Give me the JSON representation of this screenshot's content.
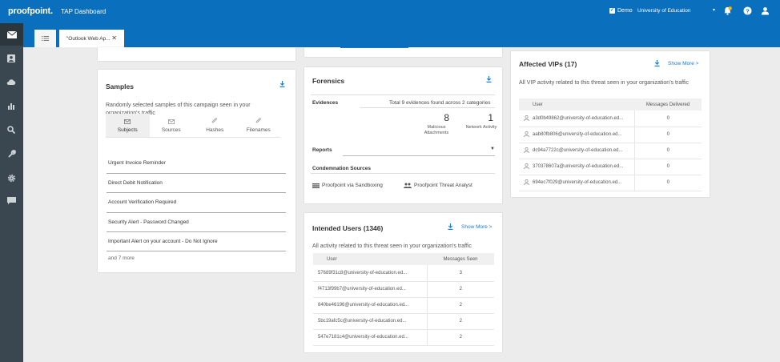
{
  "header": {
    "logo": "proofpoint.",
    "title": "TAP Dashboard",
    "demo_label": "Demo",
    "organization": "University of Education"
  },
  "tabs": [
    {
      "label": "\"Outlook Web Ap...",
      "close": "✕"
    }
  ],
  "samples": {
    "title": "Samples",
    "description": "Randomly selected samples of this campaign seen in your organization's traffic",
    "tabs": [
      "Subjects",
      "Sources",
      "Hashes",
      "Filenames"
    ],
    "subjects": [
      "Urgent Invoice Reminder",
      "Direct Debit Notification",
      "Account Verification Required",
      "Security Alert - Password Changed",
      "Important Alert on your account - Do Not Ignore"
    ],
    "more": "and 7 more"
  },
  "forensics": {
    "title": "Forensics",
    "evidences_label": "Evidences",
    "evidences_summary": "Total 9 evidences found across 2 categories",
    "malicious_count": "8",
    "malicious_label_1": "Malicious",
    "malicious_label_2": "Attachments",
    "network_count": "1",
    "network_label": "Network Activity",
    "reports_label": "Reports",
    "condemnation_label": "Condemnation Sources",
    "sources": [
      "Proofpoint via Sandboxing",
      "Proofpoint Threat Analyst"
    ]
  },
  "intended_users": {
    "title": "Intended Users (1346)",
    "show_more": "Show More >",
    "description": "All activity related to this threat seen in your organization's traffic",
    "columns": [
      "User",
      "Messages Seen"
    ],
    "rows": [
      {
        "user": "57689f31c8@university-of-education.ed...",
        "count": "3"
      },
      {
        "user": "f4713f99b7@university-of-education.ed...",
        "count": "2"
      },
      {
        "user": "840be46196@university-of-education.ed...",
        "count": "2"
      },
      {
        "user": "5bc19afc5c@university-of-education.ed...",
        "count": "2"
      },
      {
        "user": "547e7181c4@university-of-education.ed...",
        "count": "2"
      }
    ]
  },
  "affected_vips": {
    "title": "Affected VIPs (17)",
    "show_more": "Show More >",
    "description": "All VIP activity related to this threat seen in your organization's traffic",
    "columns": [
      "User",
      "Messages Delivered"
    ],
    "rows": [
      {
        "user": "a3d0b49862@university-of-education.ed...",
        "count": "0"
      },
      {
        "user": "aab80fb806@university-of-education.ed...",
        "count": "0"
      },
      {
        "user": "dc94a7722c@university-of-education.ed...",
        "count": "0"
      },
      {
        "user": "370378607a@university-of-education.ed...",
        "count": "0"
      },
      {
        "user": "694ec7f029@university-of-education.ed...",
        "count": "0"
      }
    ]
  },
  "colors": {
    "brand": "#0a6fbd",
    "sidebar": "#3a4750",
    "notify": "#f5b400"
  }
}
